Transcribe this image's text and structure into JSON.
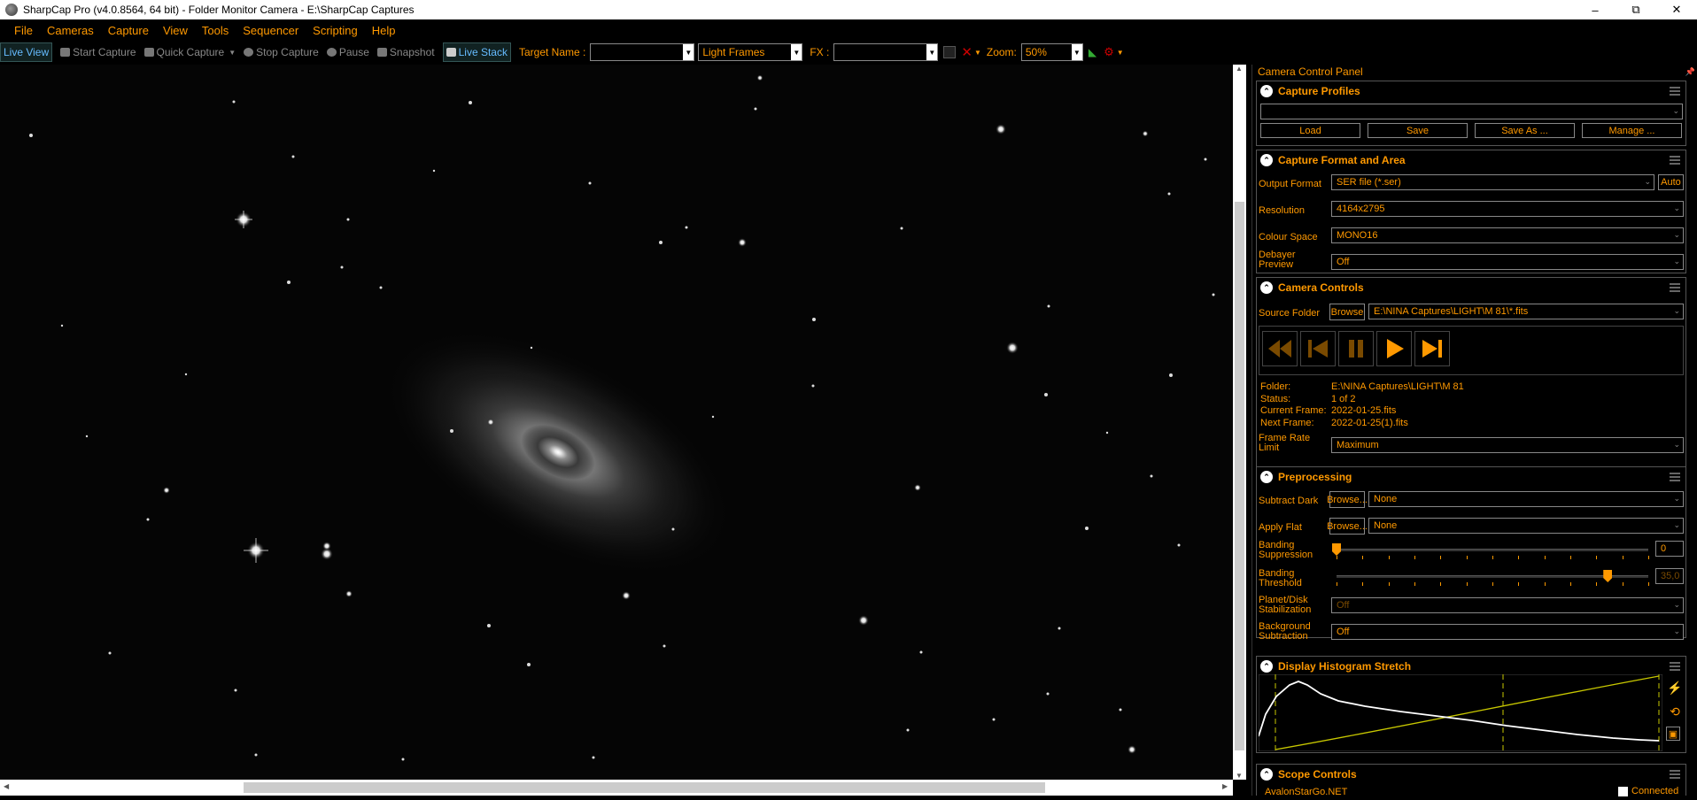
{
  "window": {
    "title": "SharpCap Pro (v4.0.8564, 64 bit) - Folder Monitor Camera - E:\\SharpCap Captures",
    "minimize": "–",
    "maximize": "⧉",
    "close": "✕"
  },
  "menu": [
    "File",
    "Cameras",
    "Capture",
    "View",
    "Tools",
    "Sequencer",
    "Scripting",
    "Help"
  ],
  "toolbar": {
    "live_view": "Live View",
    "start_capture": "Start Capture",
    "quick_capture": "Quick Capture",
    "stop_capture": "Stop Capture",
    "pause": "Pause",
    "snapshot": "Snapshot",
    "live_stack": "Live Stack",
    "target_name_label": "Target Name :",
    "target_name_value": "",
    "frame_type": "Light Frames",
    "fx_label": "FX :",
    "fx_value": "",
    "zoom_label": "Zoom:",
    "zoom_value": "50%"
  },
  "panel": {
    "title": "Camera Control Panel",
    "pin": "📌",
    "capture_profiles": {
      "title": "Capture Profiles",
      "profile_value": "",
      "load": "Load",
      "save": "Save",
      "save_as": "Save As ...",
      "manage": "Manage ..."
    },
    "capture_format": {
      "title": "Capture Format and Area",
      "output_format_label": "Output Format",
      "output_format_value": "SER file (*.ser)",
      "auto": "Auto",
      "resolution_label": "Resolution",
      "resolution_value": "4164x2795",
      "colour_space_label": "Colour Space",
      "colour_space_value": "MONO16",
      "debayer_label_1": "Debayer",
      "debayer_label_2": "Preview",
      "debayer_value": "Off"
    },
    "camera_controls": {
      "title": "Camera Controls",
      "source_folder_label": "Source Folder",
      "browse": "Browse",
      "source_folder_value": "E:\\NINA Captures\\LIGHT\\M 81\\*.fits",
      "folder_label": "Folder:",
      "folder_value": "E:\\NINA Captures\\LIGHT\\M 81",
      "status_label": "Status:",
      "status_value": "1 of 2",
      "current_frame_label": "Current Frame:",
      "current_frame_value": "2022-01-25.fits",
      "next_frame_label": "Next Frame:",
      "next_frame_value": "2022-01-25(1).fits",
      "frame_rate_label_1": "Frame Rate",
      "frame_rate_label_2": "Limit",
      "frame_rate_value": "Maximum"
    },
    "preprocessing": {
      "title": "Preprocessing",
      "subtract_dark_label": "Subtract Dark",
      "browse_dark": "Browse...",
      "subtract_dark_value": "None",
      "apply_flat_label": "Apply Flat",
      "browse_flat": "Browse...",
      "apply_flat_value": "None",
      "banding_supp_label_1": "Banding",
      "banding_supp_label_2": "Suppression",
      "banding_supp_value": "0",
      "banding_supp_level": 0.0,
      "banding_thresh_label_1": "Banding",
      "banding_thresh_label_2": "Threshold",
      "banding_thresh_value": "35,0",
      "banding_thresh_level": 0.87,
      "stabilization_label_1": "Planet/Disk",
      "stabilization_label_2": "Stabilization",
      "stabilization_value": "Off",
      "background_label_1": "Background",
      "background_label_2": "Subtraction",
      "background_value": "Off"
    },
    "histogram": {
      "title": "Display Histogram Stretch"
    },
    "scope": {
      "title": "Scope Controls",
      "scope_name": "AvalonStarGo.NET",
      "connected": "Connected"
    }
  },
  "colors": {
    "accent": "#ff9900",
    "background": "#000000",
    "histogram_curve": "#c8c800"
  }
}
